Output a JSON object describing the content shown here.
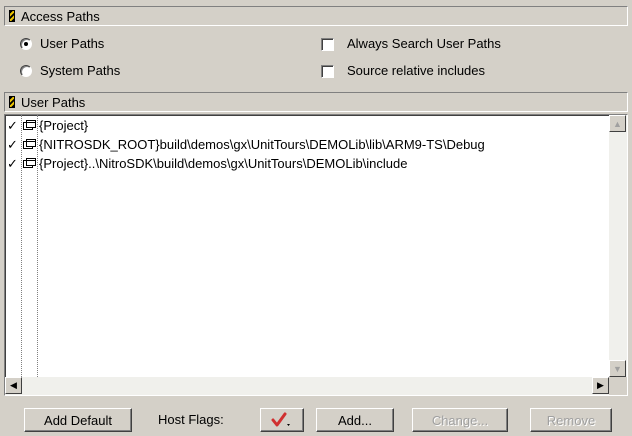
{
  "access_paths": {
    "header": "Access Paths",
    "user_paths_radio": "User Paths",
    "system_paths_radio": "System Paths",
    "always_search_user_paths": "Always Search User Paths",
    "source_relative_includes": "Source relative includes",
    "selected_radio": "User Paths"
  },
  "user_paths": {
    "header": "User Paths",
    "rows": [
      {
        "checked": "✓",
        "path": "{Project}"
      },
      {
        "checked": "✓",
        "path": "{NITROSDK_ROOT}build\\demos\\gx\\UnitTours\\DEMOLib\\lib\\ARM9-TS\\Debug"
      },
      {
        "checked": "✓",
        "path": "{Project}..\\NitroSDK\\build\\demos\\gx\\UnitTours\\DEMOLib\\include"
      }
    ]
  },
  "buttons": {
    "add_default": "Add Default",
    "host_flags_label": "Host Flags:",
    "add": "Add...",
    "change": "Change...",
    "remove": "Remove"
  },
  "colors": {
    "background": "#d4d0c8",
    "host_flags_check": "#d03030"
  }
}
